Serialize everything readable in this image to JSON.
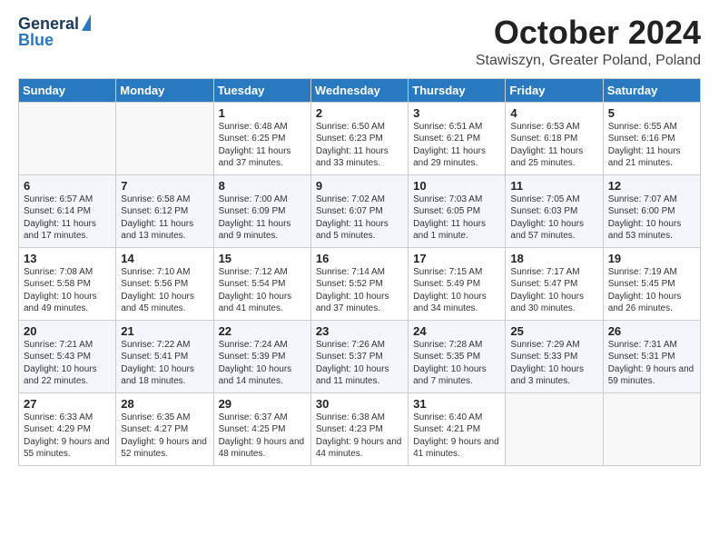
{
  "logo": {
    "general": "General",
    "blue": "Blue"
  },
  "header": {
    "month": "October 2024",
    "location": "Stawiszyn, Greater Poland, Poland"
  },
  "weekdays": [
    "Sunday",
    "Monday",
    "Tuesday",
    "Wednesday",
    "Thursday",
    "Friday",
    "Saturday"
  ],
  "weeks": [
    [
      {
        "day": "",
        "sunrise": "",
        "sunset": "",
        "daylight": ""
      },
      {
        "day": "",
        "sunrise": "",
        "sunset": "",
        "daylight": ""
      },
      {
        "day": "1",
        "sunrise": "Sunrise: 6:48 AM",
        "sunset": "Sunset: 6:25 PM",
        "daylight": "Daylight: 11 hours and 37 minutes."
      },
      {
        "day": "2",
        "sunrise": "Sunrise: 6:50 AM",
        "sunset": "Sunset: 6:23 PM",
        "daylight": "Daylight: 11 hours and 33 minutes."
      },
      {
        "day": "3",
        "sunrise": "Sunrise: 6:51 AM",
        "sunset": "Sunset: 6:21 PM",
        "daylight": "Daylight: 11 hours and 29 minutes."
      },
      {
        "day": "4",
        "sunrise": "Sunrise: 6:53 AM",
        "sunset": "Sunset: 6:18 PM",
        "daylight": "Daylight: 11 hours and 25 minutes."
      },
      {
        "day": "5",
        "sunrise": "Sunrise: 6:55 AM",
        "sunset": "Sunset: 6:16 PM",
        "daylight": "Daylight: 11 hours and 21 minutes."
      }
    ],
    [
      {
        "day": "6",
        "sunrise": "Sunrise: 6:57 AM",
        "sunset": "Sunset: 6:14 PM",
        "daylight": "Daylight: 11 hours and 17 minutes."
      },
      {
        "day": "7",
        "sunrise": "Sunrise: 6:58 AM",
        "sunset": "Sunset: 6:12 PM",
        "daylight": "Daylight: 11 hours and 13 minutes."
      },
      {
        "day": "8",
        "sunrise": "Sunrise: 7:00 AM",
        "sunset": "Sunset: 6:09 PM",
        "daylight": "Daylight: 11 hours and 9 minutes."
      },
      {
        "day": "9",
        "sunrise": "Sunrise: 7:02 AM",
        "sunset": "Sunset: 6:07 PM",
        "daylight": "Daylight: 11 hours and 5 minutes."
      },
      {
        "day": "10",
        "sunrise": "Sunrise: 7:03 AM",
        "sunset": "Sunset: 6:05 PM",
        "daylight": "Daylight: 11 hours and 1 minute."
      },
      {
        "day": "11",
        "sunrise": "Sunrise: 7:05 AM",
        "sunset": "Sunset: 6:03 PM",
        "daylight": "Daylight: 10 hours and 57 minutes."
      },
      {
        "day": "12",
        "sunrise": "Sunrise: 7:07 AM",
        "sunset": "Sunset: 6:00 PM",
        "daylight": "Daylight: 10 hours and 53 minutes."
      }
    ],
    [
      {
        "day": "13",
        "sunrise": "Sunrise: 7:08 AM",
        "sunset": "Sunset: 5:58 PM",
        "daylight": "Daylight: 10 hours and 49 minutes."
      },
      {
        "day": "14",
        "sunrise": "Sunrise: 7:10 AM",
        "sunset": "Sunset: 5:56 PM",
        "daylight": "Daylight: 10 hours and 45 minutes."
      },
      {
        "day": "15",
        "sunrise": "Sunrise: 7:12 AM",
        "sunset": "Sunset: 5:54 PM",
        "daylight": "Daylight: 10 hours and 41 minutes."
      },
      {
        "day": "16",
        "sunrise": "Sunrise: 7:14 AM",
        "sunset": "Sunset: 5:52 PM",
        "daylight": "Daylight: 10 hours and 37 minutes."
      },
      {
        "day": "17",
        "sunrise": "Sunrise: 7:15 AM",
        "sunset": "Sunset: 5:49 PM",
        "daylight": "Daylight: 10 hours and 34 minutes."
      },
      {
        "day": "18",
        "sunrise": "Sunrise: 7:17 AM",
        "sunset": "Sunset: 5:47 PM",
        "daylight": "Daylight: 10 hours and 30 minutes."
      },
      {
        "day": "19",
        "sunrise": "Sunrise: 7:19 AM",
        "sunset": "Sunset: 5:45 PM",
        "daylight": "Daylight: 10 hours and 26 minutes."
      }
    ],
    [
      {
        "day": "20",
        "sunrise": "Sunrise: 7:21 AM",
        "sunset": "Sunset: 5:43 PM",
        "daylight": "Daylight: 10 hours and 22 minutes."
      },
      {
        "day": "21",
        "sunrise": "Sunrise: 7:22 AM",
        "sunset": "Sunset: 5:41 PM",
        "daylight": "Daylight: 10 hours and 18 minutes."
      },
      {
        "day": "22",
        "sunrise": "Sunrise: 7:24 AM",
        "sunset": "Sunset: 5:39 PM",
        "daylight": "Daylight: 10 hours and 14 minutes."
      },
      {
        "day": "23",
        "sunrise": "Sunrise: 7:26 AM",
        "sunset": "Sunset: 5:37 PM",
        "daylight": "Daylight: 10 hours and 11 minutes."
      },
      {
        "day": "24",
        "sunrise": "Sunrise: 7:28 AM",
        "sunset": "Sunset: 5:35 PM",
        "daylight": "Daylight: 10 hours and 7 minutes."
      },
      {
        "day": "25",
        "sunrise": "Sunrise: 7:29 AM",
        "sunset": "Sunset: 5:33 PM",
        "daylight": "Daylight: 10 hours and 3 minutes."
      },
      {
        "day": "26",
        "sunrise": "Sunrise: 7:31 AM",
        "sunset": "Sunset: 5:31 PM",
        "daylight": "Daylight: 9 hours and 59 minutes."
      }
    ],
    [
      {
        "day": "27",
        "sunrise": "Sunrise: 6:33 AM",
        "sunset": "Sunset: 4:29 PM",
        "daylight": "Daylight: 9 hours and 55 minutes."
      },
      {
        "day": "28",
        "sunrise": "Sunrise: 6:35 AM",
        "sunset": "Sunset: 4:27 PM",
        "daylight": "Daylight: 9 hours and 52 minutes."
      },
      {
        "day": "29",
        "sunrise": "Sunrise: 6:37 AM",
        "sunset": "Sunset: 4:25 PM",
        "daylight": "Daylight: 9 hours and 48 minutes."
      },
      {
        "day": "30",
        "sunrise": "Sunrise: 6:38 AM",
        "sunset": "Sunset: 4:23 PM",
        "daylight": "Daylight: 9 hours and 44 minutes."
      },
      {
        "day": "31",
        "sunrise": "Sunrise: 6:40 AM",
        "sunset": "Sunset: 4:21 PM",
        "daylight": "Daylight: 9 hours and 41 minutes."
      },
      {
        "day": "",
        "sunrise": "",
        "sunset": "",
        "daylight": ""
      },
      {
        "day": "",
        "sunrise": "",
        "sunset": "",
        "daylight": ""
      }
    ]
  ]
}
